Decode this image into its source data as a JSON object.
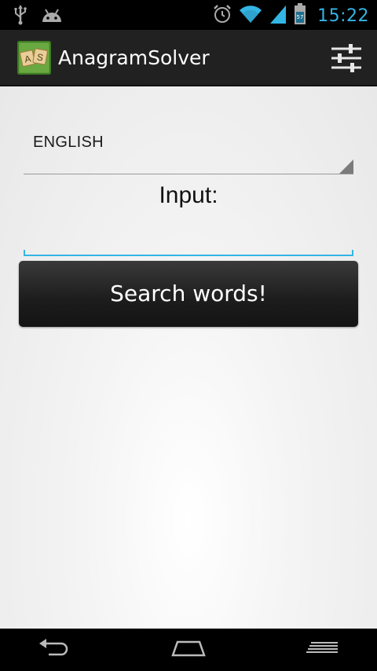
{
  "status_bar": {
    "time": "15:22",
    "icons": [
      "usb-icon",
      "android-icon",
      "alarm-icon",
      "wifi-icon",
      "signal-icon",
      "battery-icon"
    ],
    "accent_color": "#33b5e5"
  },
  "action_bar": {
    "title": "AnagramSolver",
    "app_icon": "anagram-tiles-icon",
    "settings_icon": "sliders-icon"
  },
  "form": {
    "language_value": "ENGLISH",
    "input_label": "Input:",
    "input_value": "",
    "search_button_label": "Search words!"
  },
  "nav_bar": {
    "icons": [
      "back-icon",
      "home-icon",
      "recent-apps-icon"
    ]
  }
}
